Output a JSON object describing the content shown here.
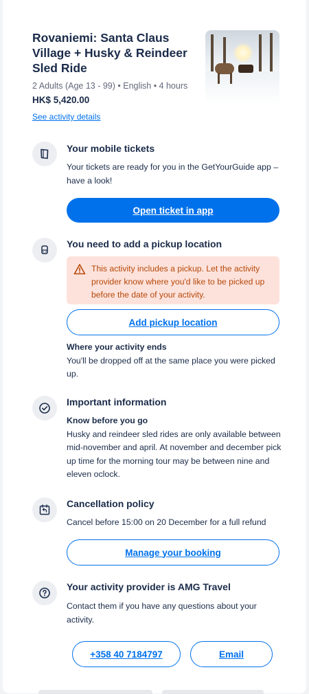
{
  "activity": {
    "title": "Rovaniemi: Santa Claus Village + Husky & Reindeer Sled Ride",
    "meta": "2 Adults (Age 13 - 99) • English • 4 hours",
    "price": "HK$ 5,420.00",
    "details_link": "See activity details"
  },
  "tickets": {
    "title": "Your mobile tickets",
    "text": "Your tickets are ready for you in the GetYourGuide app – have a look!",
    "button": "Open ticket in app"
  },
  "pickup": {
    "title": "You need to add a pickup location",
    "alert": "This activity includes a pickup. Let the activity provider know where you'd like to be picked up before the date of your activity.",
    "button": "Add pickup location",
    "ends_title": "Where your activity ends",
    "ends_text": "You'll be dropped off at the same place you were picked up."
  },
  "important": {
    "title": "Important information",
    "sub_title": "Know before you go",
    "text": "Husky and reindeer sled rides are only available between mid-november and april. At november and december pick up time for the morning tour may be between nine and eleven oclock."
  },
  "cancellation": {
    "title": "Cancellation policy",
    "text": "Cancel before 15:00 on 20 December for a full refund",
    "button": "Manage your booking"
  },
  "provider": {
    "title": "Your activity provider is AMG Travel",
    "text": "Contact them if you have any questions about your activity.",
    "phone_button": "+358 40 7184797",
    "email_button": "Email"
  },
  "colors": {
    "accent": "#0071eb",
    "heading": "#1a2b49",
    "alert_bg": "#fde2dc",
    "alert_text": "#b54808"
  }
}
